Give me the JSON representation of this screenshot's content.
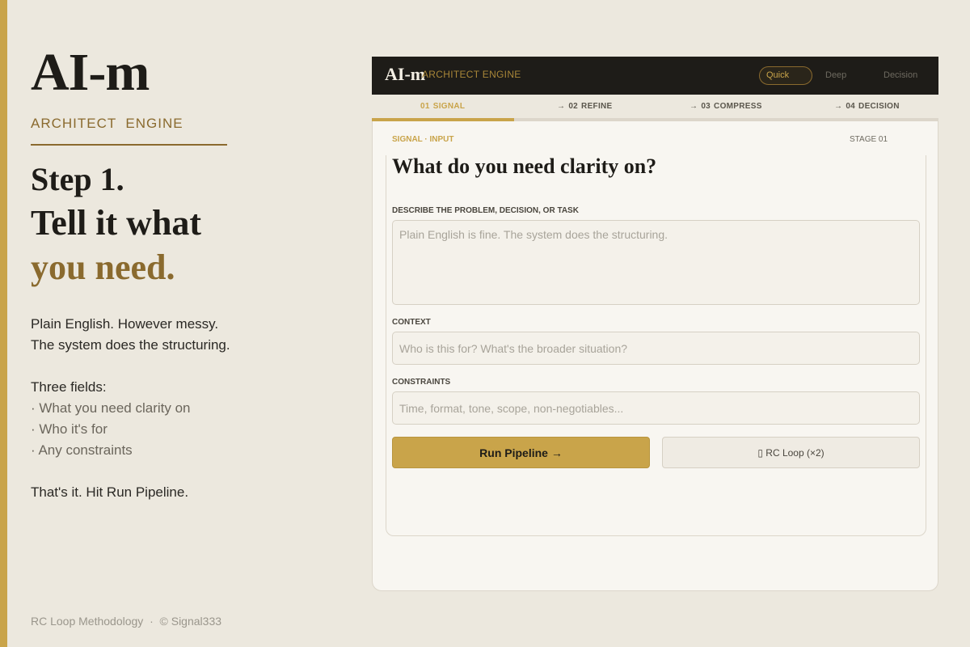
{
  "intro": {
    "logo": "AI-m",
    "subtitle": "ARCHITECT  ENGINE",
    "step_line1": "Step 1.",
    "step_line2": "Tell it what",
    "step_line3": "you need.",
    "body_line1": "Plain English. However messy.",
    "body_line2": "The system does the structuring.",
    "fields_heading": "Three fields:",
    "bullets": [
      "· What you need clarity on",
      "· Who it's for",
      "· Any constraints"
    ],
    "closing": "That's it. Hit Run Pipeline.",
    "footer": "RC Loop Methodology  ·  © Signal333"
  },
  "app": {
    "logo": "AI-m",
    "subtitle": "ARCHITECT ENGINE",
    "modes": [
      {
        "label": "Quick",
        "active": true
      },
      {
        "label": "Deep",
        "active": false
      },
      {
        "label": "Decision",
        "active": false
      }
    ],
    "stages": [
      {
        "num": "01",
        "label": "SIGNAL",
        "prefix": "",
        "active": true
      },
      {
        "num": "02",
        "label": "REFINE",
        "prefix": "→",
        "active": false
      },
      {
        "num": "03",
        "label": "COMPRESS",
        "prefix": "→",
        "active": false
      },
      {
        "num": "04",
        "label": "DECISION",
        "prefix": "→",
        "active": false
      }
    ],
    "section_label": "SIGNAL · INPUT",
    "stage_tag": "STAGE 01",
    "question": "What do you need clarity on?",
    "fields": [
      {
        "label": "DESCRIBE THE PROBLEM, DECISION, OR TASK",
        "placeholder": "Plain English is fine. The system does the structuring.",
        "value": ""
      },
      {
        "label": "CONTEXT",
        "placeholder": "Who is this for? What's the broader situation?",
        "value": ""
      },
      {
        "label": "CONSTRAINTS",
        "placeholder": "Time, format, tone, scope, non-negotiables...",
        "value": ""
      }
    ],
    "run_button": "Run Pipeline →",
    "loop_button": "▯ RC Loop (×2)"
  },
  "colors": {
    "background": "#ece8de",
    "accent_gold": "#c9a44a",
    "accent_brown": "#8a6a2e",
    "topbar": "#1e1c18"
  }
}
